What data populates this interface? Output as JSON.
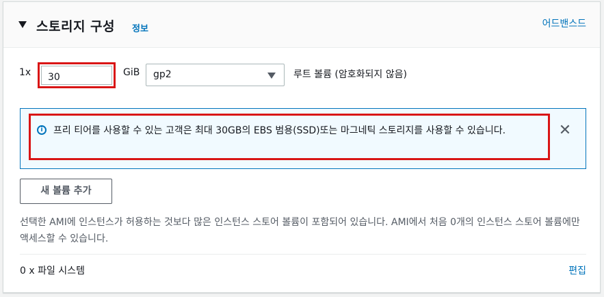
{
  "section": {
    "title": "스토리지 구성",
    "info_link": "정보",
    "advanced_link": "어드밴스드"
  },
  "volume": {
    "multiplier": "1x",
    "size_value": "30",
    "unit": "GiB",
    "volume_type": "gp2",
    "root_label": "루트 볼륨  (암호화되지 않음)"
  },
  "alert": {
    "text": "프리 티어를 사용할 수 있는 고객은 최대 30GB의 EBS 범용(SSD)또는 마그네틱 스토리지를 사용할 수 있습니다.",
    "close_symbol": "✕",
    "icon": "info-icon"
  },
  "actions": {
    "add_volume_label": "새 볼륨 추가"
  },
  "description": "선택한 AMI에 인스턴스가 허용하는 것보다 많은 인스턴스 스토어 볼륨이 포함되어 있습니다. AMI에서 처음 0개의 인스턴스 스토어 볼륨에만 액세스할 수 있습니다.",
  "file_systems": {
    "label": "0 x 파일 시스템",
    "edit_link": "편집"
  },
  "colors": {
    "link": "#0073bb",
    "highlight": "#d91515",
    "alert_bg": "#f1faff"
  }
}
